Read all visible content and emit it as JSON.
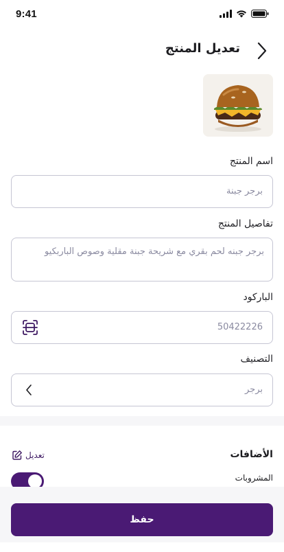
{
  "status_bar": {
    "time": "9:41",
    "icons": [
      "signal-icon",
      "wifi-icon",
      "battery-icon"
    ]
  },
  "header": {
    "title": "تعديل المنتج",
    "back_icon": "chevron-right-icon"
  },
  "product": {
    "image_alt": "burger-photo"
  },
  "form": {
    "name": {
      "label": "اسم المنتج",
      "value": "برجر جبنة"
    },
    "details": {
      "label": "تفاصيل المنتج",
      "value": "برجر جبنه لحم بقري مع شريحة جبنة مقلية وصوص الباربكيو"
    },
    "barcode": {
      "label": "الباركود",
      "value": "50422226",
      "icon": "barcode-scan-icon"
    },
    "category": {
      "label": "التصنيف",
      "value": "برجر",
      "icon": "chevron-left-icon"
    }
  },
  "addons": {
    "title": "الأضافات",
    "edit_label": "تعديل",
    "edit_icon": "edit-icon",
    "items": [
      {
        "label": "المشروبات",
        "enabled": true
      }
    ]
  },
  "actions": {
    "save_label": "حفظ"
  },
  "colors": {
    "primary": "#4a1a74",
    "border": "#c5c5d3",
    "placeholder": "#8a8aa0",
    "background_alt": "#f6f6f8"
  }
}
